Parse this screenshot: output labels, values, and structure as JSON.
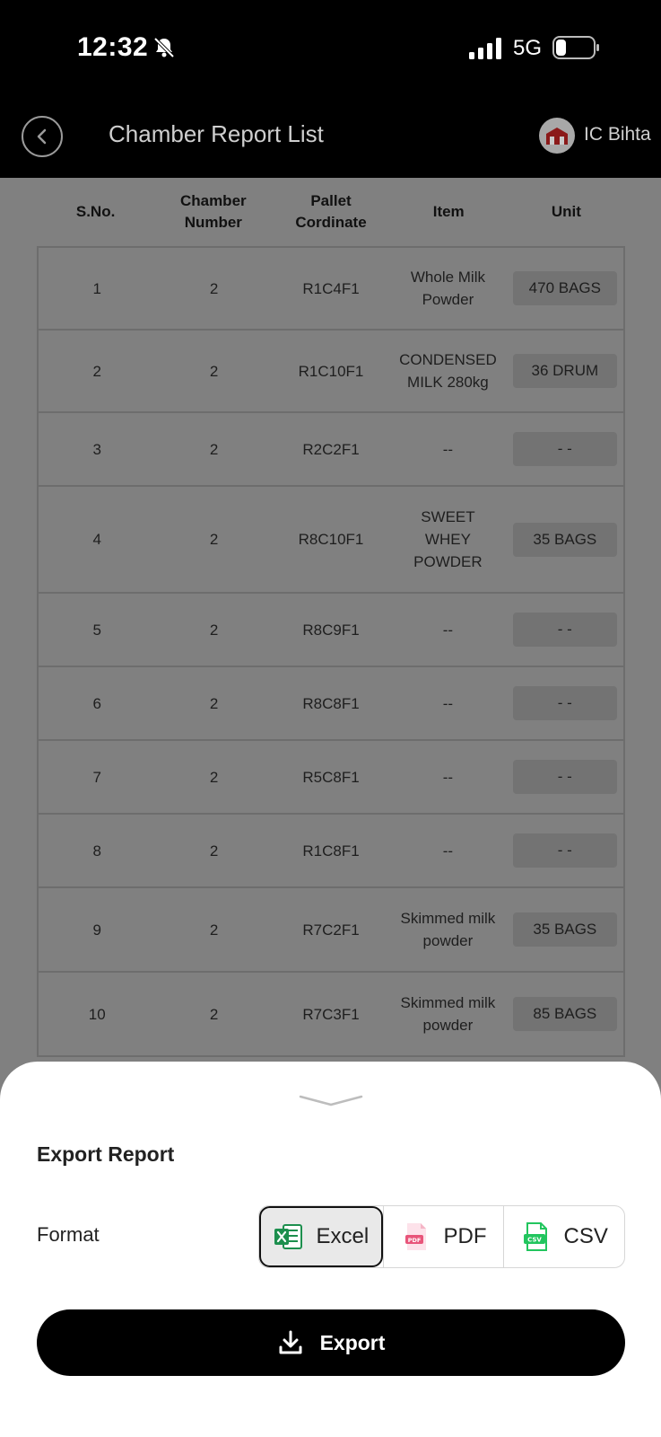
{
  "status_bar": {
    "time": "12:32",
    "network": "5G"
  },
  "header": {
    "title": "Chamber Report List",
    "user_name": "IC Bihta"
  },
  "table": {
    "columns": [
      {
        "line1": "S.No.",
        "line2": ""
      },
      {
        "line1": "Chamber",
        "line2": "Number"
      },
      {
        "line1": "Pallet",
        "line2": "Cordinate"
      },
      {
        "line1": "Item",
        "line2": ""
      },
      {
        "line1": "Unit",
        "line2": ""
      }
    ],
    "rows": [
      {
        "sno": "1",
        "chamber": "2",
        "pallet": "R1C4F1",
        "item": [
          "Whole Milk",
          "Powder"
        ],
        "unit": "470 BAGS"
      },
      {
        "sno": "2",
        "chamber": "2",
        "pallet": "R1C10F1",
        "item": [
          "CONDENSED",
          "MILK 280kg"
        ],
        "unit": "36 DRUM"
      },
      {
        "sno": "3",
        "chamber": "2",
        "pallet": "R2C2F1",
        "item": [
          "--"
        ],
        "unit": "- -"
      },
      {
        "sno": "4",
        "chamber": "2",
        "pallet": "R8C10F1",
        "item": [
          "SWEET",
          "WHEY",
          "POWDER"
        ],
        "unit": "35 BAGS"
      },
      {
        "sno": "5",
        "chamber": "2",
        "pallet": "R8C9F1",
        "item": [
          "--"
        ],
        "unit": "- -"
      },
      {
        "sno": "6",
        "chamber": "2",
        "pallet": "R8C8F1",
        "item": [
          "--"
        ],
        "unit": "- -"
      },
      {
        "sno": "7",
        "chamber": "2",
        "pallet": "R5C8F1",
        "item": [
          "--"
        ],
        "unit": "- -"
      },
      {
        "sno": "8",
        "chamber": "2",
        "pallet": "R1C8F1",
        "item": [
          "--"
        ],
        "unit": "- -"
      },
      {
        "sno": "9",
        "chamber": "2",
        "pallet": "R7C2F1",
        "item": [
          "Skimmed milk",
          "powder"
        ],
        "unit": "35 BAGS"
      },
      {
        "sno": "10",
        "chamber": "2",
        "pallet": "R7C3F1",
        "item": [
          "Skimmed milk",
          "powder"
        ],
        "unit": "85 BAGS"
      }
    ]
  },
  "export_sheet": {
    "title": "Export Report",
    "format_label": "Format",
    "formats": [
      {
        "label": "Excel",
        "icon": "excel-icon",
        "selected": true
      },
      {
        "label": "PDF",
        "icon": "pdf-icon",
        "selected": false
      },
      {
        "label": "CSV",
        "icon": "csv-icon",
        "selected": false
      }
    ],
    "export_label": "Export"
  },
  "colors": {
    "overlay": "#808080",
    "header_bg": "#000000",
    "accent": "#000000",
    "excel_green": "#1d8f4e",
    "pdf_pink": "#e8557a",
    "csv_green": "#22c55e"
  }
}
